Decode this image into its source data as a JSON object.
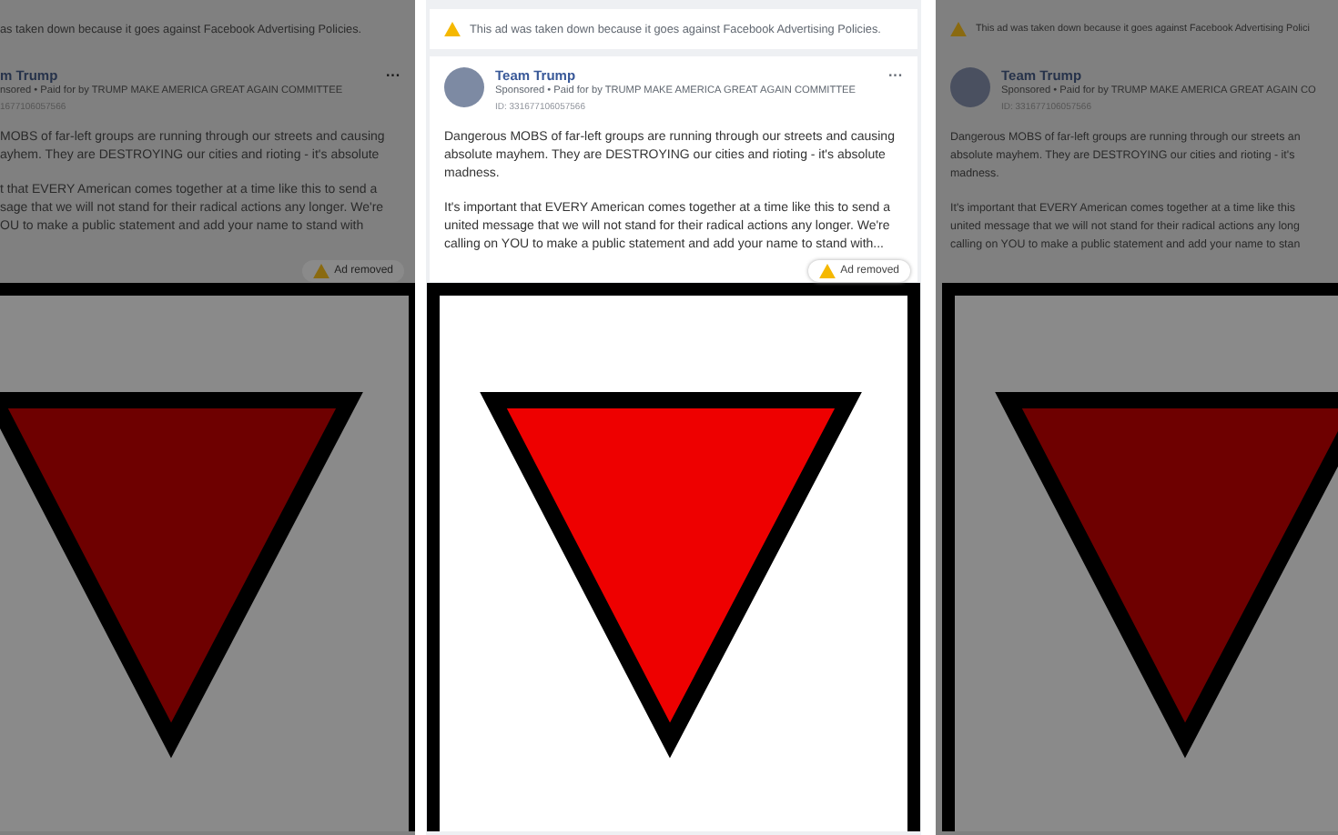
{
  "panels": [
    {
      "kind": "left",
      "dimmed": true,
      "notice": "as taken down because it goes against Facebook Advertising Policies.",
      "author": "m Trump",
      "sponsor": "nsored • Paid for by TRUMP MAKE AMERICA GREAT AGAIN COMMITTEE",
      "ad_id": "1677106057566",
      "menu": "···",
      "paragraphs": [
        [
          "MOBS of far-left groups are running through our streets and causing",
          "ayhem. They are DESTROYING our cities and rioting - it's absolute"
        ],
        [
          "t that EVERY American comes together at a time like this to send a",
          "sage that we will not stand for their radical actions any longer. We're",
          "OU to make a public statement and add your name to stand with"
        ]
      ],
      "badge": "Ad removed"
    },
    {
      "kind": "middle",
      "dimmed": false,
      "notice": "This ad was taken down because it goes against Facebook Advertising Policies.",
      "author": "Team Trump",
      "sponsor": "Sponsored • Paid for by TRUMP MAKE AMERICA GREAT AGAIN COMMITTEE",
      "ad_id": "ID: 331677106057566",
      "menu": "···",
      "paragraphs": [
        [
          "Dangerous MOBS of far-left groups are running through our streets and causing",
          "absolute mayhem. They are DESTROYING our cities and rioting - it's absolute",
          "madness."
        ],
        [
          "It's important that EVERY American comes together at a time like this to send a",
          "united message that we will not stand for their radical actions any longer. We're",
          "calling on YOU to make a public statement and add your name to stand with..."
        ]
      ],
      "badge": "Ad removed"
    },
    {
      "kind": "right",
      "dimmed": true,
      "notice": "This ad was taken down because it goes against Facebook Advertising Polici",
      "author": "Team Trump",
      "sponsor": "Sponsored • Paid for by TRUMP MAKE AMERICA GREAT AGAIN CO",
      "ad_id": "ID: 331677106057566",
      "paragraphs": [
        [
          "Dangerous MOBS of far-left groups are running through our streets an",
          "absolute mayhem. They are DESTROYING our cities and rioting - it's",
          "madness."
        ],
        [
          "It's important that EVERY American comes together at a time like this",
          "united message that we will not stand for their radical actions any long",
          "calling on YOU to make a public statement and add your name to stan"
        ]
      ]
    }
  ]
}
